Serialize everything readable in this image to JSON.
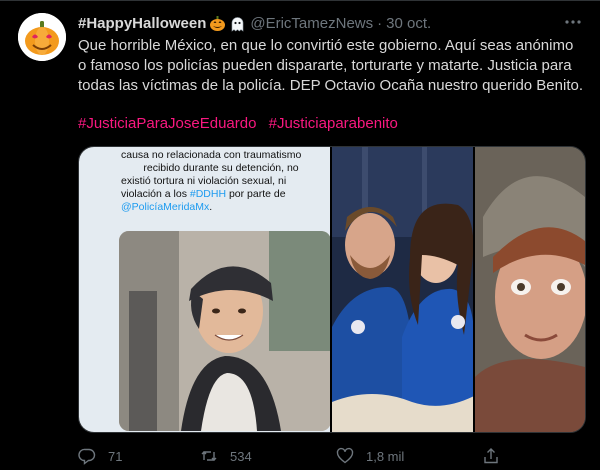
{
  "tweet": {
    "display_name": "#HappyHalloween",
    "handle": "@EricTamezNews",
    "separator": "·",
    "date": "30 oct.",
    "text_lines": [
      "Que horrible México, en que lo convirtió este gobierno. Aquí seas anónimo",
      "o famoso los policías pueden dispararte, torturarte y matarte. Justicia para",
      "todas las víctimas de la policía. DEP Octavio Ocaña nuestro querido Benito."
    ],
    "hashtags": [
      "#JusticiaParaJoseEduardo",
      "#Justiciaparabenito"
    ],
    "name_emojis": [
      "jack-o-lantern",
      "ghost"
    ]
  },
  "media": {
    "document_lines": [
      "causa no relacionada con traumatismo",
      "recibido durante su detención, no",
      "existió tortura ni violación sexual, ni",
      "violación a los ",
      "#DDHH",
      " por parte de",
      "@PolicíaMeridaMx",
      "."
    ]
  },
  "actions": {
    "reply_count": "71",
    "retweet_count": "534",
    "like_count": "1,8 mil",
    "reply_icon": "reply-icon",
    "retweet_icon": "retweet-icon",
    "like_icon": "heart-icon",
    "share_icon": "share-icon"
  },
  "colors": {
    "background": "#000000",
    "text": "#d9d9d9",
    "secondary": "#6e767d",
    "hashtag": "#f91880",
    "link": "#1d9bf0"
  }
}
